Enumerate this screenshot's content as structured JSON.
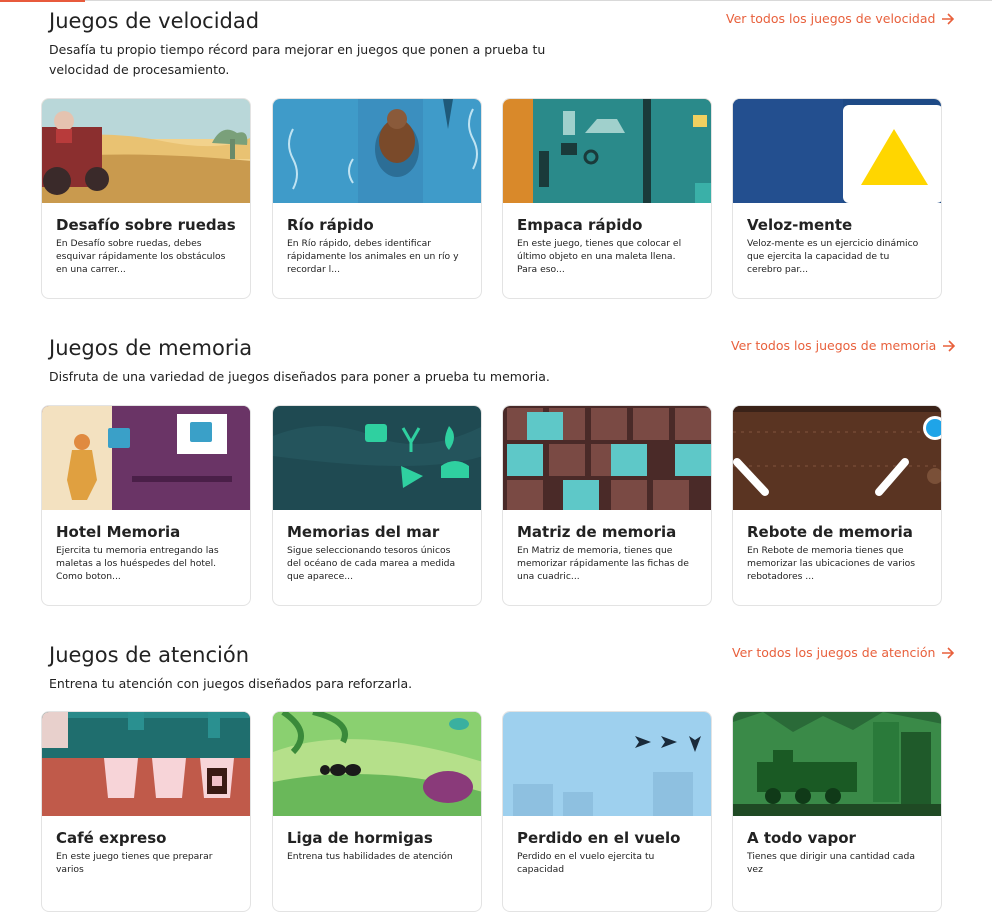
{
  "sections": [
    {
      "title": "Juegos de velocidad",
      "description": "Desafía tu propio tiempo récord para mejorar en juegos que ponen a prueba tu velocidad de procesamiento.",
      "see_all": "Ver todos los juegos de velocidad",
      "games": [
        {
          "title": "Desafío sobre ruedas",
          "description": "En Desafío sobre ruedas, debes esquivar rápidamente los obstáculos en una carrer..."
        },
        {
          "title": "Río rápido",
          "description": "En Río rápido, debes identificar rápidamente los animales en un río y recordar l..."
        },
        {
          "title": "Empaca rápido",
          "description": "En este juego, tienes que colocar el último objeto en una maleta llena. Para eso..."
        },
        {
          "title": "Veloz-mente",
          "description": "Veloz-mente es un ejercicio dinámico que ejercita la capacidad de tu cerebro par..."
        }
      ]
    },
    {
      "title": "Juegos de memoria",
      "description": "Disfruta de una variedad de juegos diseñados para poner a prueba tu memoria.",
      "see_all": "Ver todos los juegos de memoria",
      "games": [
        {
          "title": "Hotel Memoria",
          "description": "Ejercita tu memoria entregando las maletas a los huéspedes del hotel. Como boton..."
        },
        {
          "title": "Memorias del mar",
          "description": "Sigue seleccionando tesoros únicos del océano de cada marea a medida que aparece..."
        },
        {
          "title": "Matriz de memoria",
          "description": "En Matriz de memoria, tienes que memorizar rápidamente las fichas de una cuadric..."
        },
        {
          "title": "Rebote de memoria",
          "description": "En Rebote de memoria tienes que memorizar las ubicaciones de varios rebotadores ..."
        }
      ]
    },
    {
      "title": "Juegos de atención",
      "description": "Entrena tu atención con juegos diseñados para reforzarla.",
      "see_all": "Ver todos los juegos de atención",
      "games": [
        {
          "title": "Café expreso",
          "description": "En este juego tienes que preparar varios"
        },
        {
          "title": "Liga de hormigas",
          "description": "Entrena tus habilidades de atención"
        },
        {
          "title": "Perdido en el vuelo",
          "description": "Perdido en el vuelo ejercita tu capacidad"
        },
        {
          "title": "A todo vapor",
          "description": "Tienes que dirigir una cantidad cada vez"
        }
      ]
    }
  ],
  "colors": {
    "accent": "#e8603c",
    "text": "#222222",
    "card_border": "#e3e3e3"
  },
  "icons": {
    "see_all": "arrow-right-icon"
  }
}
